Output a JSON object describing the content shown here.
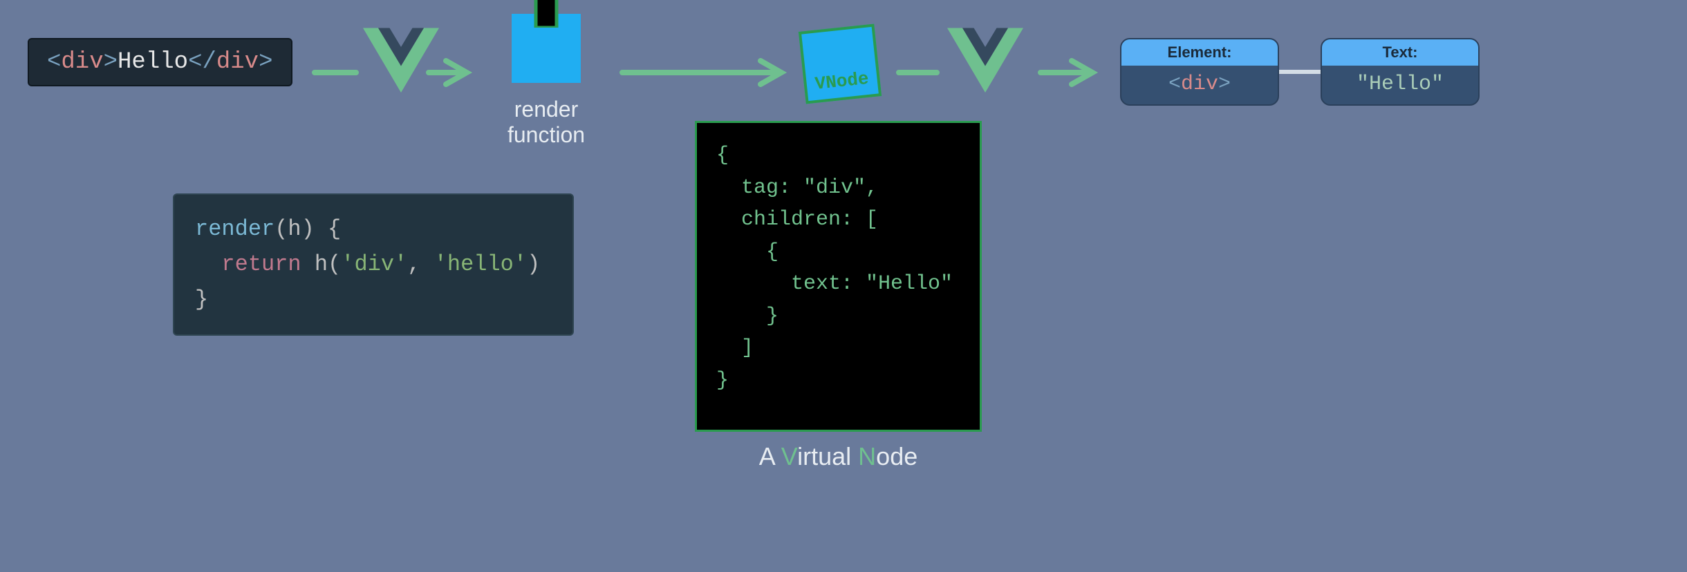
{
  "template": {
    "open_lt": "<",
    "open_tag": "div",
    "open_gt": ">",
    "text": "Hello",
    "close_lt": "</",
    "close_tag": "div",
    "close_gt": ">"
  },
  "render_label": "render function",
  "vnode_icon_label": "VNode",
  "render_code": {
    "l1_fn": "render",
    "l1_rest": "(h) {",
    "l2_ret": "return",
    "l2_call": " h(",
    "l2_s1": "'div'",
    "l2_comma": ", ",
    "l2_s2": "'hello'",
    "l2_close": ")",
    "l3": "}"
  },
  "vnode_json_text": "{\n  tag: \"div\",\n  children: [\n    {\n      text: \"Hello\"\n    }\n  ]\n}",
  "vnode_caption": {
    "a": "A ",
    "v": "V",
    "irtual": "irtual ",
    "n": "N",
    "ode": "ode"
  },
  "output": {
    "element": {
      "header": "Element:",
      "lt": "<",
      "tag": "div",
      "gt": ">"
    },
    "text": {
      "header": "Text:",
      "value": "\"Hello\""
    }
  }
}
